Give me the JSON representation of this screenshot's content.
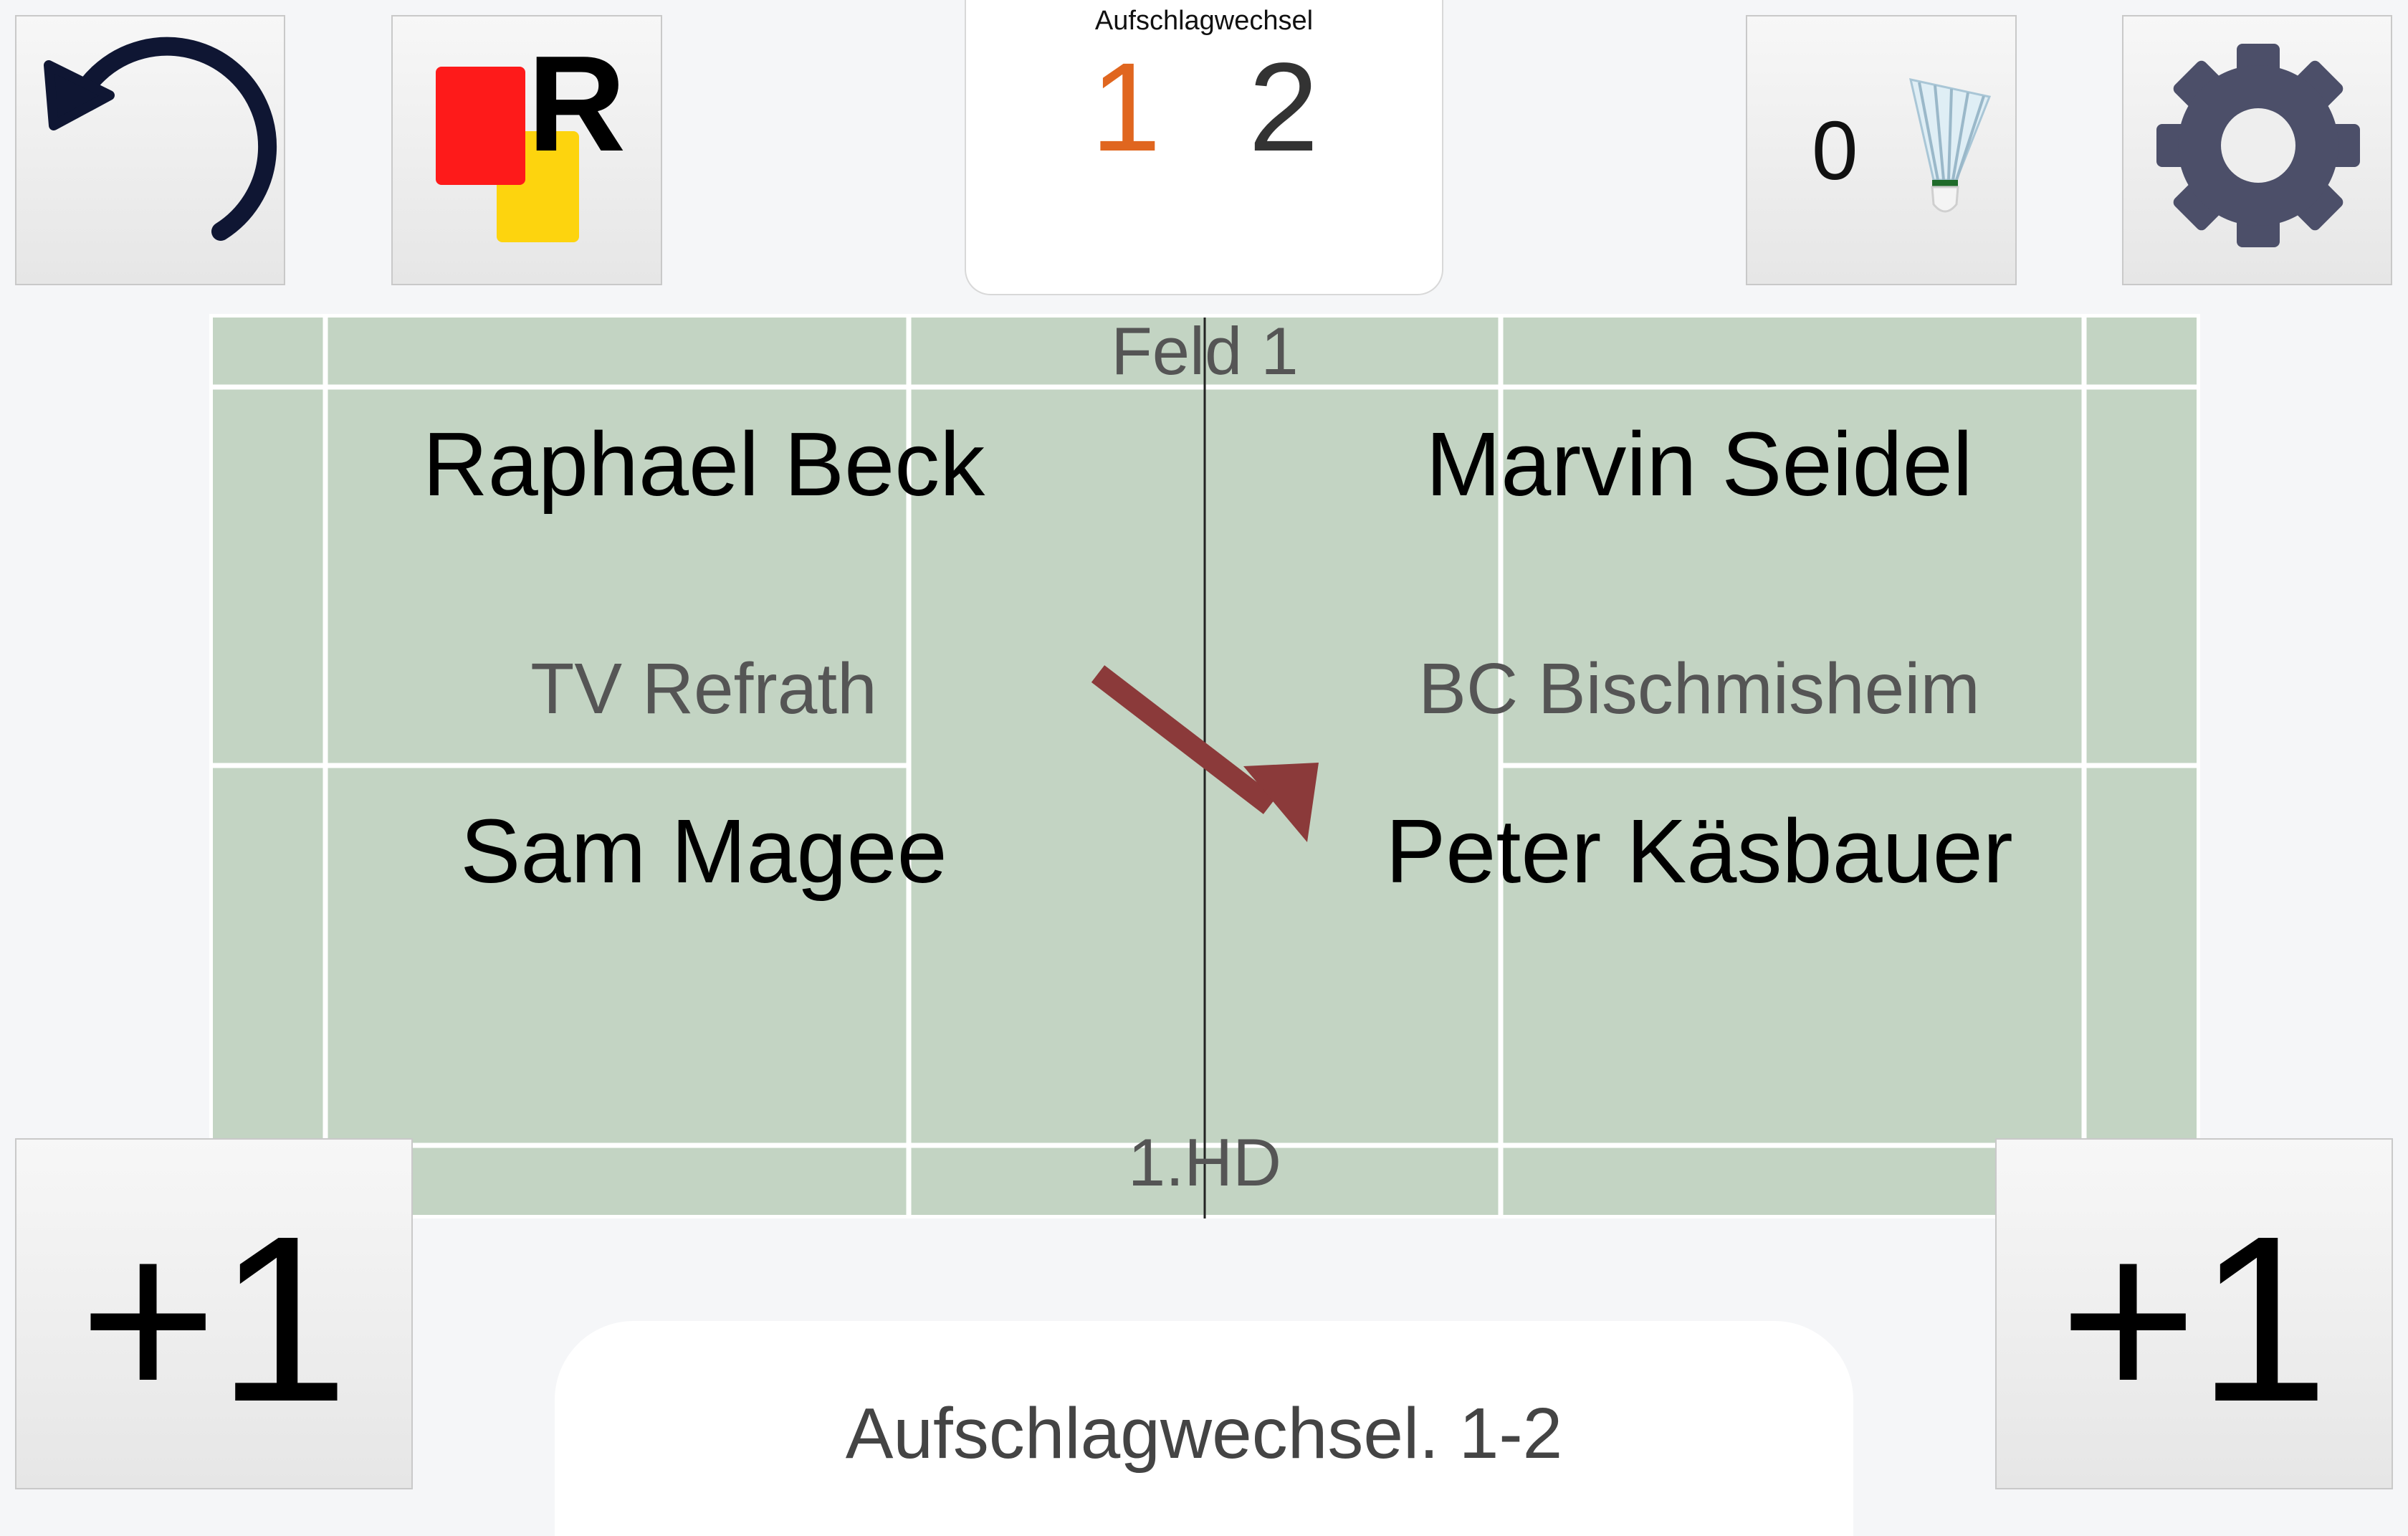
{
  "toolbar": {
    "undo_icon": "undo-arrow-icon",
    "cards_icon": "referee-cards-icon",
    "cards_letter": "R",
    "shuttle_count": "0",
    "shuttle_icon": "shuttlecock-icon",
    "settings_icon": "gear-icon"
  },
  "scoreboard": {
    "label": "Aufschlagwechsel",
    "left_score": "1",
    "right_score": "2",
    "left_color": "#e0661f",
    "right_color": "#333333"
  },
  "court": {
    "field": "Feld 1",
    "discipline": "1.HD",
    "left": {
      "player_1": "Raphael Beck",
      "team": "TV Refrath",
      "player_2": "Sam Magee"
    },
    "right": {
      "player_1": "Marvin Seidel",
      "team": "BC Bischmisheim",
      "player_2": "Peter Käsbauer"
    },
    "serve_arrow_color": "#8b3a3a",
    "court_color": "#c3d4c3"
  },
  "actions": {
    "plus_left": "+1",
    "plus_right": "+1"
  },
  "status": {
    "text": "Aufschlagwechsel. 1-2"
  }
}
